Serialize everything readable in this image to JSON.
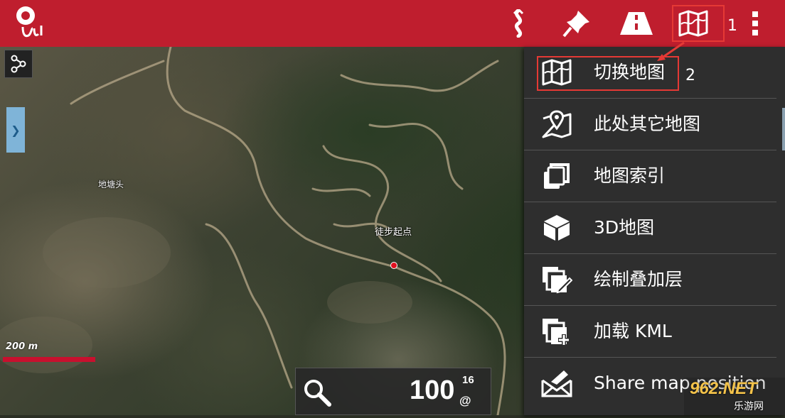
{
  "app": {
    "name": "Orux Maps"
  },
  "toolbar": {
    "items": [
      {
        "name": "route-icon"
      },
      {
        "name": "waypoint-pin-icon"
      },
      {
        "name": "road-icon"
      },
      {
        "name": "map-icon"
      },
      {
        "name": "overflow-menu-icon"
      }
    ],
    "annotation_1": "1",
    "annotation_2": "2"
  },
  "map": {
    "labels": {
      "village": "地塘头",
      "start_point": "徒步起点"
    },
    "scale": {
      "text": "200 m"
    },
    "zoom": {
      "value": "100",
      "level": "16",
      "unit": "@"
    }
  },
  "menu": {
    "items": [
      {
        "label": "切换地图",
        "icon": "map-icon"
      },
      {
        "label": "此处其它地图",
        "icon": "map-location-icon"
      },
      {
        "label": "地图索引",
        "icon": "layers-copy-icon"
      },
      {
        "label": "3D地图",
        "icon": "cube-icon"
      },
      {
        "label": "绘制叠加层",
        "icon": "draw-overlay-icon"
      },
      {
        "label": "加载 KML",
        "icon": "add-layer-icon"
      },
      {
        "label": "Share map position",
        "icon": "share-envelope-icon"
      }
    ]
  },
  "watermark": {
    "text": "962.NET",
    "subtext": "乐游网"
  },
  "colors": {
    "topbar": "#bf1e2e",
    "menu_bg": "#2e2e2e",
    "highlight": "#e53935",
    "scale_bar": "#c8102e"
  }
}
